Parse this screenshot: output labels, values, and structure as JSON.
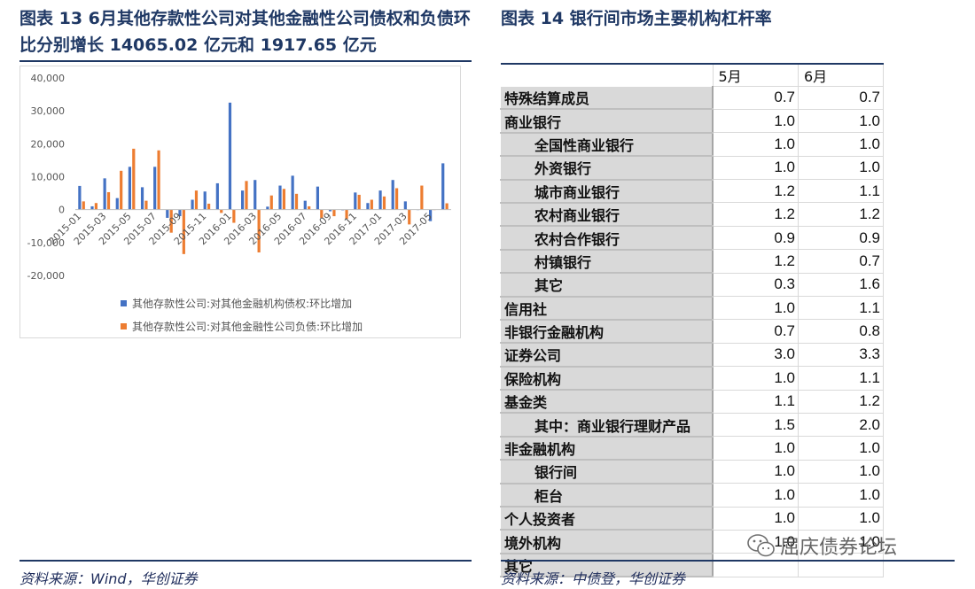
{
  "left": {
    "title": "图表 13   6月其他存款性公司对其他金融性公司债权和负债环比分别增长 14065.02 亿元和 1917.65 亿元",
    "source": "资料来源：Wind，华创证券"
  },
  "right": {
    "title": "图表 14    银行间市场主要机构杠杆率",
    "source": "资料来源：中债登，华创证券",
    "table": {
      "columns": [
        "5月",
        "6月"
      ],
      "rows": [
        {
          "label": "特殊结算成员",
          "indent": false,
          "may": "0.7",
          "jun": "0.7"
        },
        {
          "label": "商业银行",
          "indent": false,
          "may": "1.0",
          "jun": "1.0"
        },
        {
          "label": "全国性商业银行",
          "indent": true,
          "may": "1.0",
          "jun": "1.0"
        },
        {
          "label": "外资银行",
          "indent": true,
          "may": "1.0",
          "jun": "1.0"
        },
        {
          "label": "城市商业银行",
          "indent": true,
          "may": "1.2",
          "jun": "1.1"
        },
        {
          "label": "农村商业银行",
          "indent": true,
          "may": "1.2",
          "jun": "1.2"
        },
        {
          "label": "农村合作银行",
          "indent": true,
          "may": "0.9",
          "jun": "0.9"
        },
        {
          "label": "村镇银行",
          "indent": true,
          "may": "1.2",
          "jun": "0.7"
        },
        {
          "label": "其它",
          "indent": true,
          "may": "0.3",
          "jun": "1.6"
        },
        {
          "label": "信用社",
          "indent": false,
          "may": "1.0",
          "jun": "1.1"
        },
        {
          "label": "非银行金融机构",
          "indent": false,
          "may": "0.7",
          "jun": "0.8"
        },
        {
          "label": "证券公司",
          "indent": false,
          "may": "3.0",
          "jun": "3.3"
        },
        {
          "label": "保险机构",
          "indent": false,
          "may": "1.0",
          "jun": "1.1"
        },
        {
          "label": "基金类",
          "indent": false,
          "may": "1.1",
          "jun": "1.2"
        },
        {
          "label": "其中：商业银行理财产品",
          "indent": true,
          "may": "1.5",
          "jun": "2.0"
        },
        {
          "label": "非金融机构",
          "indent": false,
          "may": "1.0",
          "jun": "1.0"
        },
        {
          "label": "银行间",
          "indent": true,
          "may": "1.0",
          "jun": "1.0"
        },
        {
          "label": "柜台",
          "indent": true,
          "may": "1.0",
          "jun": "1.0"
        },
        {
          "label": "个人投资者",
          "indent": false,
          "may": "1.0",
          "jun": "1.0"
        },
        {
          "label": "境外机构",
          "indent": false,
          "may": "1.0",
          "jun": "1.0"
        },
        {
          "label": "其它",
          "indent": false,
          "may": "",
          "jun": ""
        }
      ]
    }
  },
  "watermark": {
    "text": "屈庆债券论坛",
    "icon": "wechat-icon"
  },
  "colors": {
    "series1": "#4472c4",
    "series2": "#ed7d31",
    "title": "#1f3864"
  },
  "chart_data": {
    "type": "bar",
    "title": "",
    "xlabel": "",
    "ylabel": "",
    "ylim": [
      -20000,
      40000
    ],
    "yticks": [
      -20000,
      -10000,
      0,
      10000,
      20000,
      30000,
      40000
    ],
    "ytick_labels": [
      "-20,000",
      "-10,000",
      "0",
      "10,000",
      "20,000",
      "30,000",
      "40,000"
    ],
    "grid": false,
    "legend_placement": "bottom",
    "categories": [
      "2015-01",
      "2015-02",
      "2015-03",
      "2015-04",
      "2015-05",
      "2015-06",
      "2015-07",
      "2015-08",
      "2015-09",
      "2015-10",
      "2015-11",
      "2015-12",
      "2016-01",
      "2016-02",
      "2016-03",
      "2016-04",
      "2016-05",
      "2016-06",
      "2016-07",
      "2016-08",
      "2016-09",
      "2016-10",
      "2016-11",
      "2016-12",
      "2017-01",
      "2017-02",
      "2017-03",
      "2017-04",
      "2017-05",
      "2017-06"
    ],
    "tick_labels": [
      "2015-01",
      "2015-03",
      "2015-05",
      "2015-07",
      "2015-09",
      "2015-11",
      "2016-01",
      "2016-03",
      "2016-05",
      "2016-07",
      "2016-09",
      "2016-11",
      "2017-01",
      "2017-03",
      "2017-05"
    ],
    "series": [
      {
        "name": "其他存款性公司:对其他金融机构债权:环比增加",
        "values": [
          7200,
          1000,
          9500,
          3500,
          13000,
          6800,
          13000,
          -2500,
          -2000,
          3000,
          5500,
          8000,
          32500,
          5800,
          9000,
          900,
          7300,
          10300,
          2700,
          7000,
          -500,
          -200,
          5200,
          2000,
          5800,
          9000,
          2500,
          0,
          -3500,
          14065
        ]
      },
      {
        "name": "其他存款性公司:对其他金融性公司负债:环比增加",
        "values": [
          2500,
          2000,
          5300,
          11800,
          18500,
          2700,
          18000,
          -7000,
          -13500,
          5800,
          1800,
          -1000,
          -4000,
          8700,
          -13000,
          4300,
          6300,
          4800,
          1000,
          -2500,
          -2000,
          -2800,
          4500,
          3000,
          4000,
          6500,
          -4500,
          7300,
          0,
          1918
        ]
      }
    ]
  }
}
